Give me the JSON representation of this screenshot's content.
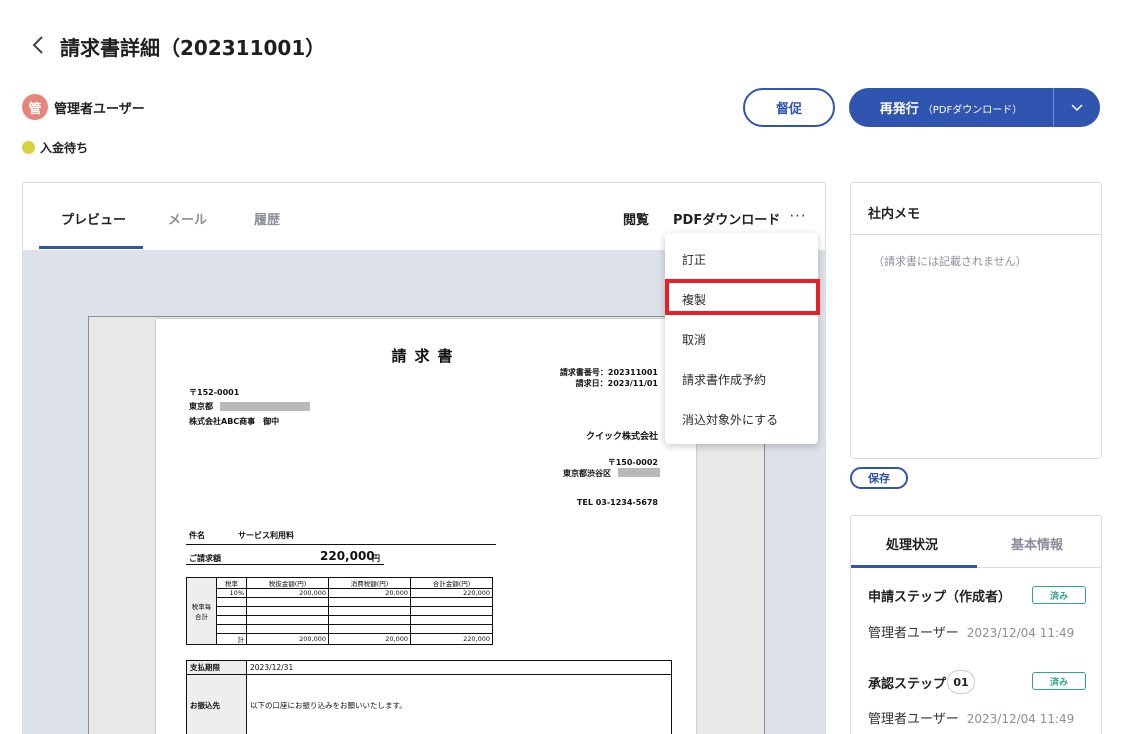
{
  "header": {
    "title": "請求書詳細（202311001）"
  },
  "user": {
    "avatar_initial": "管",
    "name": "管理者ユーザー"
  },
  "status": {
    "label": "入金待ち",
    "color": "#d6d13c"
  },
  "actions": {
    "remind_label": "督促",
    "reissue_label": "再発行",
    "reissue_sub": "（PDFダウンロード）"
  },
  "tabs": [
    {
      "label": "プレビュー",
      "active": true
    },
    {
      "label": "メール",
      "active": false
    },
    {
      "label": "履歴",
      "active": false
    }
  ],
  "toolbar": {
    "view_label": "閲覧",
    "pdf_label": "PDFダウンロード",
    "more_label": "···"
  },
  "menu": {
    "items": [
      "訂正",
      "複製",
      "取消",
      "請求書作成予約",
      "消込対象外にする"
    ],
    "highlighted": "複製"
  },
  "invoice": {
    "title": "請求書",
    "number": "請求書番号：202311001",
    "date": "請求日：2023/11/01",
    "postal": "〒152-0001",
    "address_prefix": "東京都",
    "recipient": "株式会社ABC商事　御中",
    "issuer": "クイック株式会社",
    "issuer_postal": "〒150-0002",
    "issuer_address": "東京都渋谷区",
    "issuer_tel": "TEL 03-1234-5678",
    "subject_label": "件名",
    "subject": "サービス利用料",
    "total_label": "ご請求額",
    "total": "220,000",
    "total_unit": "円",
    "tax_table": {
      "side_label_1": "税率毎",
      "side_label_2": "合計",
      "headers": [
        "税率",
        "税抜金額(円)",
        "消費税額(円)",
        "合計金額(円)"
      ],
      "row1": [
        "10%",
        "200,000",
        "20,000",
        "220,000"
      ],
      "sum_label": "計",
      "sum": [
        "200,000",
        "20,000",
        "220,000"
      ]
    },
    "due_label": "支払期限",
    "due": "2023/12/31",
    "bank_label": "お振込先",
    "bank_text": "以下の口座にお振り込みをお願いいたします。"
  },
  "memo": {
    "title": "社内メモ",
    "placeholder": "（請求書には記載されません）",
    "save_label": "保存"
  },
  "status_panel": {
    "tabs": [
      "処理状況",
      "基本情報"
    ],
    "steps": [
      {
        "title": "申請ステップ（作成者）",
        "badge": "済み",
        "user": "管理者ユーザー",
        "date": "2023/12/04 11:49"
      },
      {
        "title": "承認ステップ",
        "num": "01",
        "badge": "済み",
        "user": "管理者ユーザー",
        "date": "2023/12/04 11:49"
      }
    ]
  },
  "colors": {
    "primary": "#2f55b0",
    "highlight": "#e3212b",
    "done": "#2fa58a",
    "avatar": "#e8847a"
  }
}
